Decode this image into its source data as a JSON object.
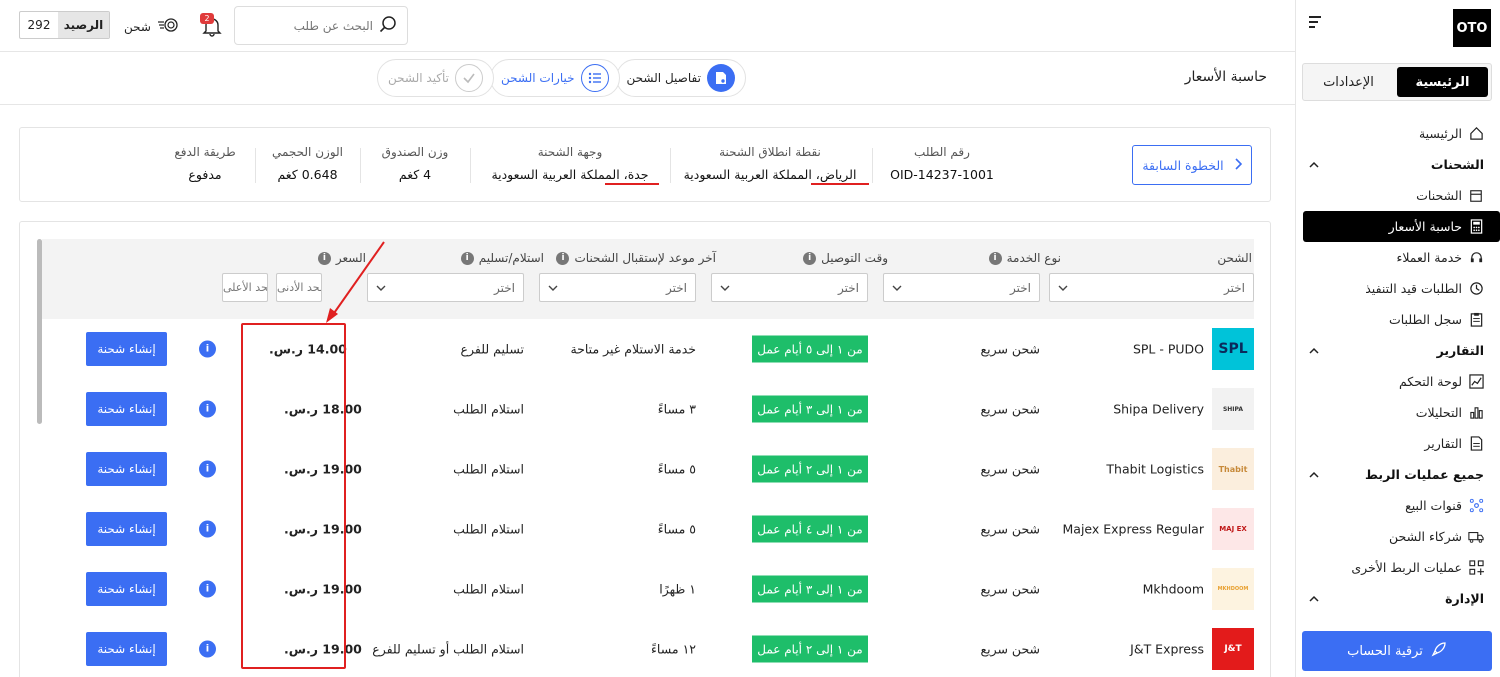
{
  "brand": {
    "logo_text": "OTO"
  },
  "sidebar": {
    "tabs": {
      "home": "الرئيسية",
      "settings": "الإعدادات"
    },
    "items": {
      "home": "الرئيسية",
      "shipments_section": "الشحنات",
      "shipments": "الشحنات",
      "calculator": "حاسبة الأسعار",
      "support": "خدمة العملاء",
      "pending": "الطلبات قيد التنفيذ",
      "log": "سجل الطلبات",
      "reports_section": "التقارير",
      "dashboard": "لوحة التحكم",
      "analytics": "التحليلات",
      "reports": "التقارير",
      "integrations_section": "جميع عمليات الربط",
      "channels": "قنوات البيع",
      "partners": "شركاء الشحن",
      "other": "عمليات الربط الأخرى",
      "admin_section": "الإدارة"
    },
    "upgrade_label": "ترقية الحساب"
  },
  "topbar": {
    "balance_value": "292",
    "balance_label": "الرصيد",
    "ship_label": "شحن",
    "notifications_count": "2",
    "search_placeholder": "البحث عن طلب"
  },
  "header": {
    "title": "حاسبة الأسعار",
    "steps": [
      "تفاصيل الشحن",
      "خيارات الشحن",
      "تأكيد الشحن"
    ]
  },
  "summary": {
    "back_label": "الخطوة السابقة",
    "order_label": "رقم الطلب",
    "order_value": "OID-14237-1001",
    "origin_label": "نقطة انطلاق الشحنة",
    "origin_value": "الرياض، المملكة العربية السعودية",
    "dest_label": "وجهة الشحنة",
    "dest_value": "جدة، المملكة العربية السعودية",
    "box_weight_label": "وزن الصندوق",
    "box_weight_value": "4 كغم",
    "vol_weight_label": "الوزن الحجمي",
    "vol_weight_value": "0.648 كغم",
    "payment_label": "طريقة الدفع",
    "payment_value": "مدفوع"
  },
  "table": {
    "headers": {
      "carrier": "الشحن",
      "service": "نوع الخدمة",
      "delivery": "وقت التوصيل",
      "cutoff": "آخر موعد لإستقبال الشحنات",
      "handover": "استلام/تسليم",
      "price": "السعر"
    },
    "select_placeholder": "اختر",
    "min_placeholder": "الحد الأدنى",
    "max_placeholder": "الحد الأعلى",
    "create_label": "إنشاء شحنة",
    "rows": [
      {
        "carrier": "SPL - PUDO",
        "logo": "SPL",
        "service": "شحن سريع",
        "delivery": "من ١ إلى ٥ أيام عمل",
        "cutoff": "خدمة الاستلام غير متاحة",
        "handover": "تسليم للفرع",
        "price": "14.00 ر.س."
      },
      {
        "carrier": "Shipa Delivery",
        "logo": "SHIPA",
        "service": "شحن سريع",
        "delivery": "من ١ إلى ٣ أيام عمل",
        "cutoff": "٣ مساءً",
        "handover": "استلام الطلب",
        "price": "18.00 ر.س."
      },
      {
        "carrier": "Thabit Logistics",
        "logo": "Thabit",
        "service": "شحن سريع",
        "delivery": "من ١ إلى ٢ أيام عمل",
        "cutoff": "٥ مساءً",
        "handover": "استلام الطلب",
        "price": "19.00 ر.س."
      },
      {
        "carrier": "Majex Express Regular",
        "logo": "MAJ EX",
        "service": "شحن سريع",
        "delivery": "من ١ إلى ٤ أيام عمل",
        "cutoff": "٥ مساءً",
        "handover": "استلام الطلب",
        "price": "19.00 ر.س."
      },
      {
        "carrier": "Mkhdoom",
        "logo": "MKHDOOM",
        "service": "شحن سريع",
        "delivery": "من ١ إلى ٣ أيام عمل",
        "cutoff": "١ ظهرًا",
        "handover": "استلام الطلب",
        "price": "19.00 ر.س."
      },
      {
        "carrier": "J&T Express",
        "logo": "J&T",
        "service": "شحن سريع",
        "delivery": "من ١ إلى ٢ أيام عمل",
        "cutoff": "١٢ مساءً",
        "handover": "استلام الطلب أو تسليم للفرع",
        "price": "19.00 ر.س."
      }
    ]
  },
  "colors": {
    "accent": "#3b6ef3",
    "success": "#1ebe6a",
    "annotation": "#e02020"
  }
}
